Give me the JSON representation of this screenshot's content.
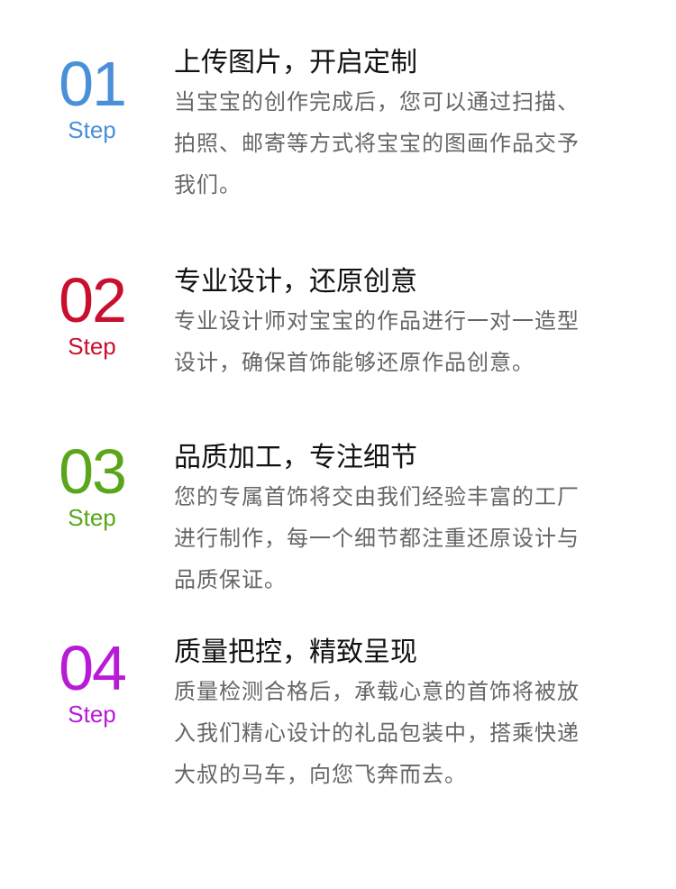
{
  "step_word": "Step",
  "steps": [
    {
      "number": "01",
      "color": "#4a90d9",
      "title": "上传图片，开启定制",
      "desc_lines": [
        "当宝宝的创作完成后，您可以通过扫描、",
        "拍照、邮寄等方式将宝宝的图画作品交予",
        "我们。"
      ]
    },
    {
      "number": "02",
      "color": "#c8102e",
      "title": "专业设计，还原创意",
      "desc_lines": [
        "专业设计师对宝宝的作品进行一对一造型",
        "设计，确保首饰能够还原作品创意。"
      ]
    },
    {
      "number": "03",
      "color": "#5aa61a",
      "title": "品质加工，专注细节",
      "desc_lines": [
        "您的专属首饰将交由我们经验丰富的工厂",
        "进行制作，每一个细节都注重还原设计与",
        "品质保证。"
      ]
    },
    {
      "number": "04",
      "color": "#b81bd6",
      "title": "质量把控，精致呈现",
      "desc_lines": [
        "质量检测合格后，承载心意的首饰将被放",
        "入我们精心设计的礼品包装中，搭乘快递",
        "大叔的马车，向您飞奔而去。"
      ]
    }
  ]
}
